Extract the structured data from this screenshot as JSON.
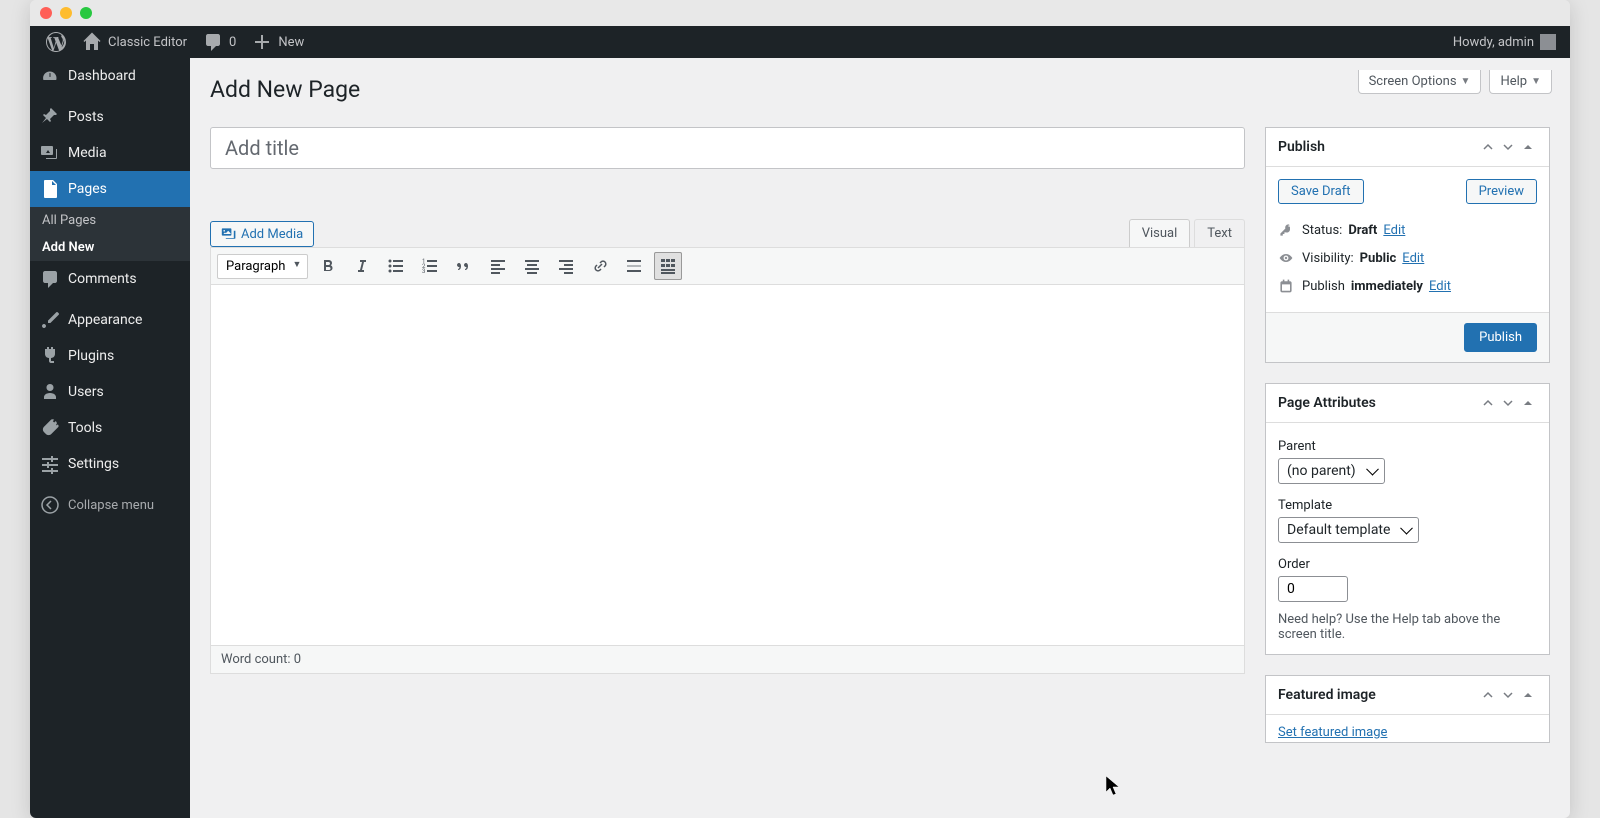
{
  "adminbar": {
    "siteName": "Classic Editor",
    "commentCount": "0",
    "newLabel": "New",
    "greeting": "Howdy, admin"
  },
  "sidebar": {
    "items": [
      {
        "label": "Dashboard",
        "name": "dashboard"
      },
      {
        "label": "Posts",
        "name": "posts"
      },
      {
        "label": "Media",
        "name": "media"
      },
      {
        "label": "Pages",
        "name": "pages",
        "current": true
      },
      {
        "label": "Comments",
        "name": "comments"
      },
      {
        "label": "Appearance",
        "name": "appearance"
      },
      {
        "label": "Plugins",
        "name": "plugins"
      },
      {
        "label": "Users",
        "name": "users"
      },
      {
        "label": "Tools",
        "name": "tools"
      },
      {
        "label": "Settings",
        "name": "settings"
      }
    ],
    "submenu": {
      "allPages": "All Pages",
      "addNew": "Add New"
    },
    "collapse": "Collapse menu"
  },
  "topbuttons": {
    "screenOptions": "Screen Options",
    "help": "Help"
  },
  "page": {
    "heading": "Add New Page",
    "titlePlaceholder": "Add title",
    "addMedia": "Add Media",
    "tabVisual": "Visual",
    "tabText": "Text",
    "formatSelect": "Paragraph",
    "wordCount": "Word count: 0"
  },
  "publish": {
    "title": "Publish",
    "saveDraft": "Save Draft",
    "preview": "Preview",
    "statusLabel": "Status:",
    "statusValue": "Draft",
    "visibilityLabel": "Visibility:",
    "visibilityValue": "Public",
    "publishLabel": "Publish",
    "publishValue": "immediately",
    "edit": "Edit",
    "publishBtn": "Publish"
  },
  "attributes": {
    "title": "Page Attributes",
    "parentLabel": "Parent",
    "parentValue": "(no parent)",
    "templateLabel": "Template",
    "templateValue": "Default template",
    "orderLabel": "Order",
    "orderValue": "0",
    "helpText": "Need help? Use the Help tab above the screen title."
  },
  "featured": {
    "title": "Featured image",
    "setLink": "Set featured image"
  }
}
